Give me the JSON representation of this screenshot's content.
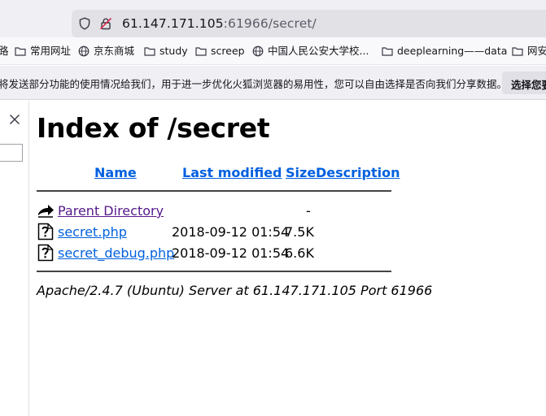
{
  "browser": {
    "url_host": "61.147.171.105",
    "url_rest": ":61966/secret/",
    "bookmarks": [
      {
        "label": "路",
        "icon": "none"
      },
      {
        "label": "常用网址",
        "icon": "folder-icon"
      },
      {
        "label": "京东商城",
        "icon": "globe-icon"
      },
      {
        "label": "study",
        "icon": "folder-icon"
      },
      {
        "label": "screep",
        "icon": "folder-icon"
      },
      {
        "label": "中国人民公安大学校...",
        "icon": "globe-icon"
      },
      {
        "label": "deeplearning——data",
        "icon": "folder-icon"
      },
      {
        "label": "网安",
        "icon": "folder-icon"
      }
    ],
    "notification": {
      "text": "将发送部分功能的使用情况给我们，用于进一步优化火狐浏览器的易用性，您可以自由选择是否向我们分享数据。",
      "button": "选择您要"
    }
  },
  "page": {
    "title": "Index of /secret",
    "columns": {
      "name": "Name",
      "modified": "Last modified",
      "size": "Size",
      "description": "Description"
    },
    "rows": [
      {
        "name": "Parent Directory",
        "date": "",
        "size": "-",
        "icon": "back-arrow-icon"
      },
      {
        "name": "secret.php",
        "date": "2018-09-12 01:54",
        "size": "7.5K",
        "icon": "unknown-file-icon"
      },
      {
        "name": "secret_debug.php",
        "date": "2018-09-12 01:54",
        "size": "6.6K",
        "icon": "unknown-file-icon"
      }
    ],
    "server_signature": "Apache/2.4.7 (Ubuntu) Server at 61.147.171.105 Port 61966"
  },
  "colors": {
    "link": "#0060df",
    "visited_link": "#551a8b",
    "chrome_bg": "#f0f0f4"
  }
}
